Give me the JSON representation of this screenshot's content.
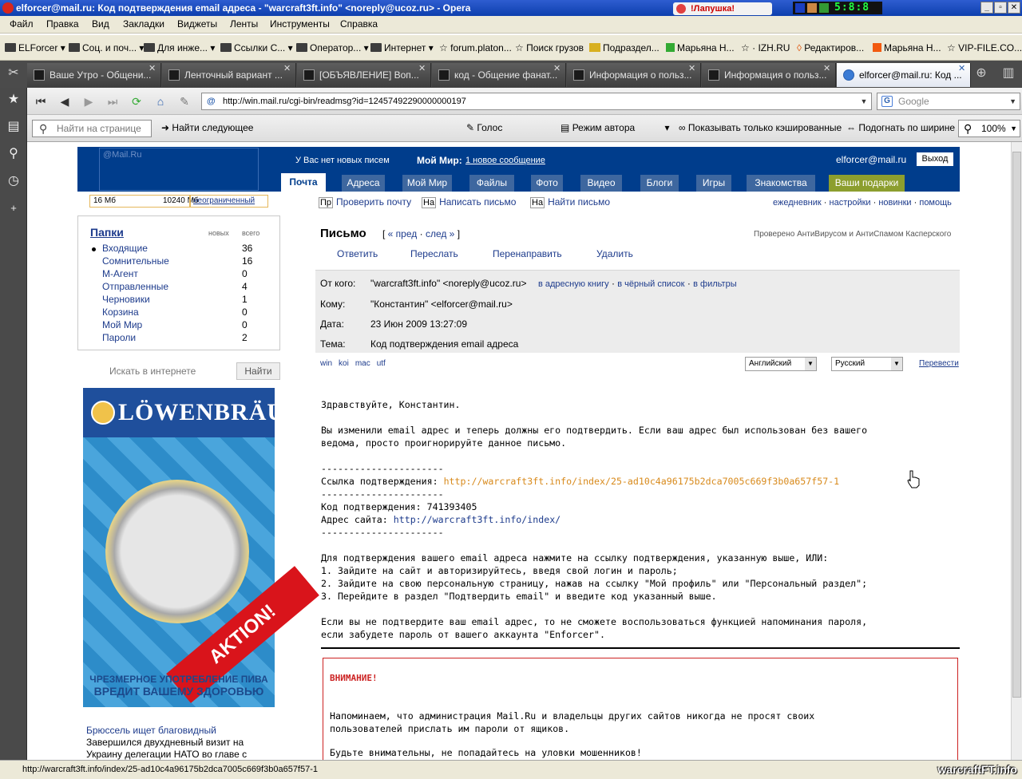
{
  "window": {
    "title": "elforcer@mail.ru: Код подтверждения email адреса - \"warcraft3ft.info\" <noreply@ucoz.ru> - Opera",
    "tray_label": "!Лапушка!",
    "meter": "5:8:8"
  },
  "menu": [
    "Файл",
    "Правка",
    "Вид",
    "Закладки",
    "Виджеты",
    "Ленты",
    "Инструменты",
    "Справка"
  ],
  "bookmarks": [
    "ELForcer",
    "Соц. и поч...",
    "Для инже...",
    "Ссылки С...",
    "Оператор...",
    "Интернет",
    "forum.platon...",
    "Поиск грузов",
    "Подраздел...",
    "Марьяна Н...",
    "· IZH.RU",
    "Редактиров...",
    "Марьяна Н...",
    "VIP-FILE.CO..."
  ],
  "tabs": [
    "Ваше Утро - Общени...",
    "Ленточный вариант ...",
    "[ОБЪЯВЛЕНИЕ] Воп...",
    "код - Общение фанат...",
    "Информация о польз...",
    "Информация о польз...",
    "elforcer@mail.ru: Код ..."
  ],
  "address": {
    "url": "http://win.mail.ru/cgi-bin/readmsg?id=12457492290000000197",
    "search_placeholder": "Google"
  },
  "findbar": {
    "placeholder": "Найти на странице",
    "next": "Найти следующее",
    "voice": "Голос",
    "author_mode": "Режим автора",
    "cached_only": "Показывать только кэшированные",
    "fit_width": "Подогнать по ширине",
    "zoom": "100%"
  },
  "header": {
    "logo": "@Mail.Ru",
    "no_letters": "У Вас нет новых писем",
    "my_world": "Мой Мир:",
    "new_message": "1 новое сообщение",
    "email": "elforcer@mail.ru",
    "exit": "Выход"
  },
  "nav": [
    "Почта",
    "Адреса",
    "Мой Мир",
    "Файлы",
    "Фото",
    "Видео",
    "Блоги",
    "Игры",
    "Знакомства",
    "Ваши подарки"
  ],
  "quota": {
    "used": "16 Мб",
    "total": "10240 Мб",
    "unlimited": "неограниченный"
  },
  "actions": {
    "check_box": "Пр",
    "check": "Проверить почту",
    "write_box": "На",
    "write": "Написать письмо",
    "find_box": "На",
    "find": "Найти письмо"
  },
  "toplinks": [
    "ежедневник",
    "настройки",
    "новинки",
    "помощь"
  ],
  "folders": {
    "title": "Папки",
    "col_new": "новых",
    "col_all": "всего",
    "items": [
      {
        "name": "Входящие",
        "count": "36"
      },
      {
        "name": "Сомнительные",
        "count": "16"
      },
      {
        "name": "М-Агент",
        "count": "0"
      },
      {
        "name": "Отправленные",
        "count": "4"
      },
      {
        "name": "Черновики",
        "count": "1"
      },
      {
        "name": "Корзина",
        "count": "0"
      },
      {
        "name": "Мой Мир",
        "count": "0"
      },
      {
        "name": "Пароли",
        "count": "2"
      }
    ]
  },
  "websearch": {
    "label": "Искать в интернете",
    "button": "Найти"
  },
  "ad": {
    "brand": "LÖWENBRÄU",
    "badge": "AKTION!",
    "warning_1": "ЧРЕЗМЕРНОЕ УПОТРЕБЛЕНИЕ ПИВА",
    "warning_2": "ВРЕДИТ ВАШЕМУ ЗДОРОВЬЮ"
  },
  "news": {
    "headline": "Брюссель ищет благовидный",
    "text_1": "Завершился двухдневный визит на",
    "text_2": "Украину делегации НАТО во главе с"
  },
  "message": {
    "heading": "Письмо",
    "prev": "« пред",
    "next": "след »",
    "checked_prefix": "Проверено",
    "antivirus": "АнтиВирусом",
    "and": "и",
    "antispam": "АнтиСпамом",
    "checked_suffix": "Касперского",
    "reply": "Ответить",
    "forward": "Переслать",
    "redirect": "Перенаправить",
    "delete": "Удалить",
    "from_label": "От кого:",
    "from": "\"warcraft3ft.info\" <noreply@ucoz.ru>",
    "to_addressbook": "в адресную книгу",
    "to_blacklist": "в чёрный список",
    "to_filters": "в фильтры",
    "to_label": "Кому:",
    "to": "\"Константин\" <elforcer@mail.ru>",
    "date_label": "Дата:",
    "date": "23 Июн 2009 13:27:09",
    "subject_label": "Тема:",
    "subject": "Код подтверждения email адреса",
    "encodings": [
      "win",
      "koi",
      "mac",
      "utf"
    ],
    "lang_from": "Английский",
    "lang_to": "Русский",
    "translate": "Перевести"
  },
  "body": {
    "greeting": "Здравствуйте, Константин.",
    "p1_1": "Вы изменили email адрес и теперь должны его подтвердить. Если ваш адрес был использован без вашего",
    "p1_2": "ведома, просто проигнорируйте данное письмо.",
    "sep": "----------------------",
    "link_label": "Ссылка подтверждения: ",
    "link": "http://warcraft3ft.info/index/25-ad10c4a96175b2dca7005c669f3b0a657f57-1",
    "code": "Код подтверждения: 741393405",
    "site_label": "Адрес сайта: ",
    "site": "http://warcraft3ft.info/index/",
    "p2": "Для подтверждения вашего email адреса нажмите на ссылку подтверждения, указанную выше, ИЛИ:",
    "s1": "1. Зайдите на сайт и авторизируйтесь, введя свой логин и пароль;",
    "s2": "2. Зайдите на свою персональную страницу, нажав на ссылку \"Мой профиль\" или \"Персональный раздел\";",
    "s3": "3. Перейдите в раздел \"Подтвердить email\" и введите код указанный выше.",
    "p3_1": "Если вы не подтвердите ваш email адрес, то не сможете воспользоваться функцией напоминания пароля,",
    "p3_2": "если забудете пароль от вашего аккаунта \"Enforcer\"."
  },
  "alert": {
    "title": "ВНИМАНИЕ!",
    "l1": "Напоминаем, что администрация Mail.Ru и владельцы других сайтов никогда не просят своих",
    "l2": "пользователей прислать им пароли от ящиков.",
    "l3": "Будьте внимательны, не попадайтесь на уловки мошенников!"
  },
  "status": {
    "url": "http://warcraft3ft.info/index/25-ad10c4a96175b2dca7005c669f3b0a657f57-1",
    "watermark": "warcraftFT.info"
  }
}
